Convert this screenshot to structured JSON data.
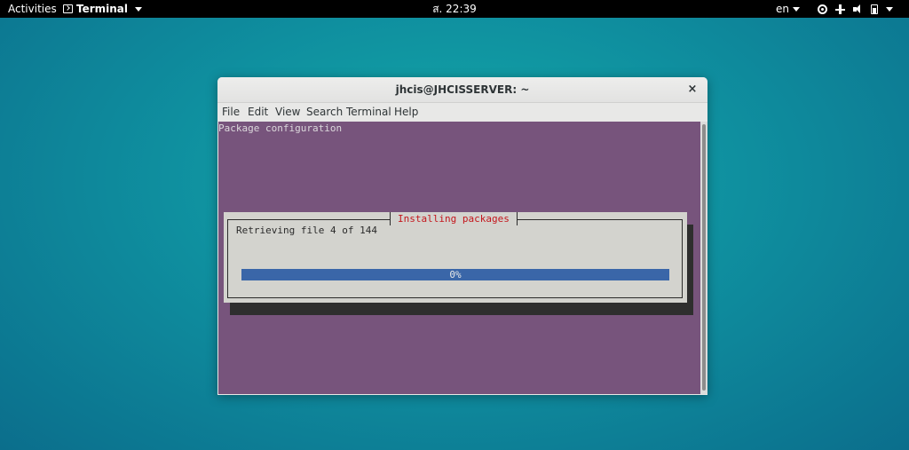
{
  "topbar": {
    "activities": "Activities",
    "app_name": "Terminal",
    "clock": "ส. 22:39",
    "language": "en",
    "tray_icons": [
      "network-icon",
      "tree-icon",
      "volume-icon",
      "battery-icon"
    ]
  },
  "window": {
    "title": "jhcis@JHCISSERVER: ~",
    "close_glyph": "×",
    "menu": [
      "File",
      "Edit",
      "View",
      "Search",
      "Terminal",
      "Help"
    ]
  },
  "terminal": {
    "header": "Package configuration",
    "background": "#77547c",
    "dialog": {
      "title": "Installing packages",
      "message": "Retrieving file 4 of 144",
      "progress_label": "0%",
      "progress_fraction": 1.0
    }
  },
  "colors": {
    "dialog_title": "#c4161c",
    "progress_bar": "#3a66a8",
    "dialog_bg": "#d3d3ce"
  }
}
